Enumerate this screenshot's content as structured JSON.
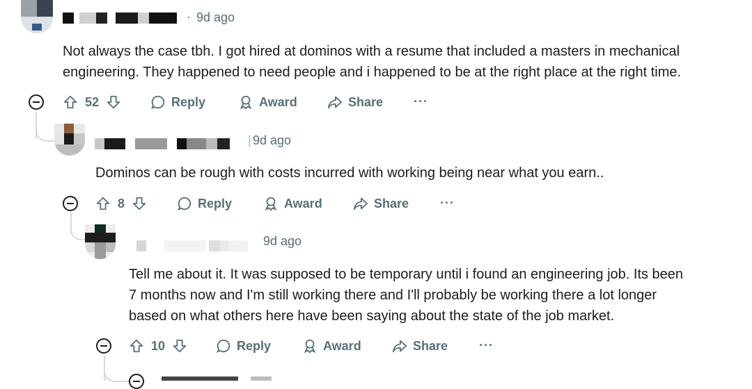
{
  "comments": [
    {
      "time": "9d ago",
      "body_lines": [
        "Not always the case tbh. I got hired at dominos with a resume that included a masters in mechanical",
        "engineering. They happened to need people and i happened to be at the right place at the right time."
      ],
      "votes": "52",
      "reply": "Reply",
      "award": "Award",
      "share": "Share",
      "more": "···"
    },
    {
      "time": "9d ago",
      "body_lines": [
        "Dominos can be rough with costs incurred with working being near what you earn.."
      ],
      "votes": "8",
      "reply": "Reply",
      "award": "Award",
      "share": "Share",
      "more": "···"
    },
    {
      "time": "9d ago",
      "body_lines": [
        "Tell me about it. It was supposed to be temporary until i found an engineering job. Its been",
        "7 months now and I'm still working there and I'll probably be working there a lot longer",
        "based on what others here have been saying about the state of the job market."
      ],
      "votes": "10",
      "reply": "Reply",
      "award": "Award",
      "share": "Share",
      "more": "···"
    }
  ],
  "colors": {
    "text": "#1c1c1c",
    "meta": "#576f76",
    "thread_line": "#d7dadc"
  },
  "icons": [
    "upvote-icon",
    "downvote-icon",
    "reply-bubble-icon",
    "award-icon",
    "share-icon",
    "collapse-icon"
  ]
}
